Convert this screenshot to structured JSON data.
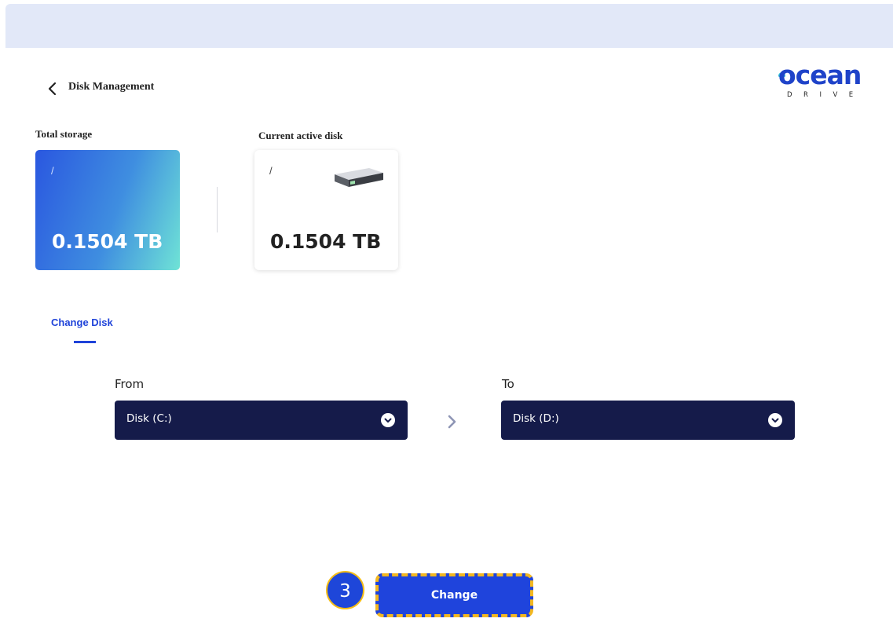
{
  "header": {
    "title": "Disk Management",
    "back_icon": "chevron-left-icon"
  },
  "logo": {
    "word": "ocean",
    "sub": "DRIVE"
  },
  "storage": {
    "total_label": "Total storage",
    "total_path": "/",
    "total_value": "0.1504 TB",
    "active_label": "Current active disk",
    "active_path": "/",
    "active_value": "0.1504 TB",
    "active_icon": "hard-drive-icon"
  },
  "tabs": {
    "active": "Change Disk"
  },
  "change_disk": {
    "from_label": "From",
    "from_value": "Disk (C:)",
    "to_label": "To",
    "to_value": "Disk (D:)",
    "arrow_icon": "chevron-right-icon"
  },
  "action": {
    "step_badge": "3",
    "button_label": "Change"
  },
  "colors": {
    "accent": "#1f44dc",
    "select_bg": "#151b4a",
    "highlight": "#f2b721",
    "topbar": "#e2e8f8"
  }
}
